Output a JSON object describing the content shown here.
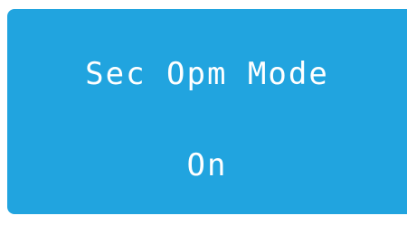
{
  "tile": {
    "title": "Sec Opm Mode",
    "value": "On",
    "background_color": "#21a4df",
    "text_color": "#ffffff"
  }
}
